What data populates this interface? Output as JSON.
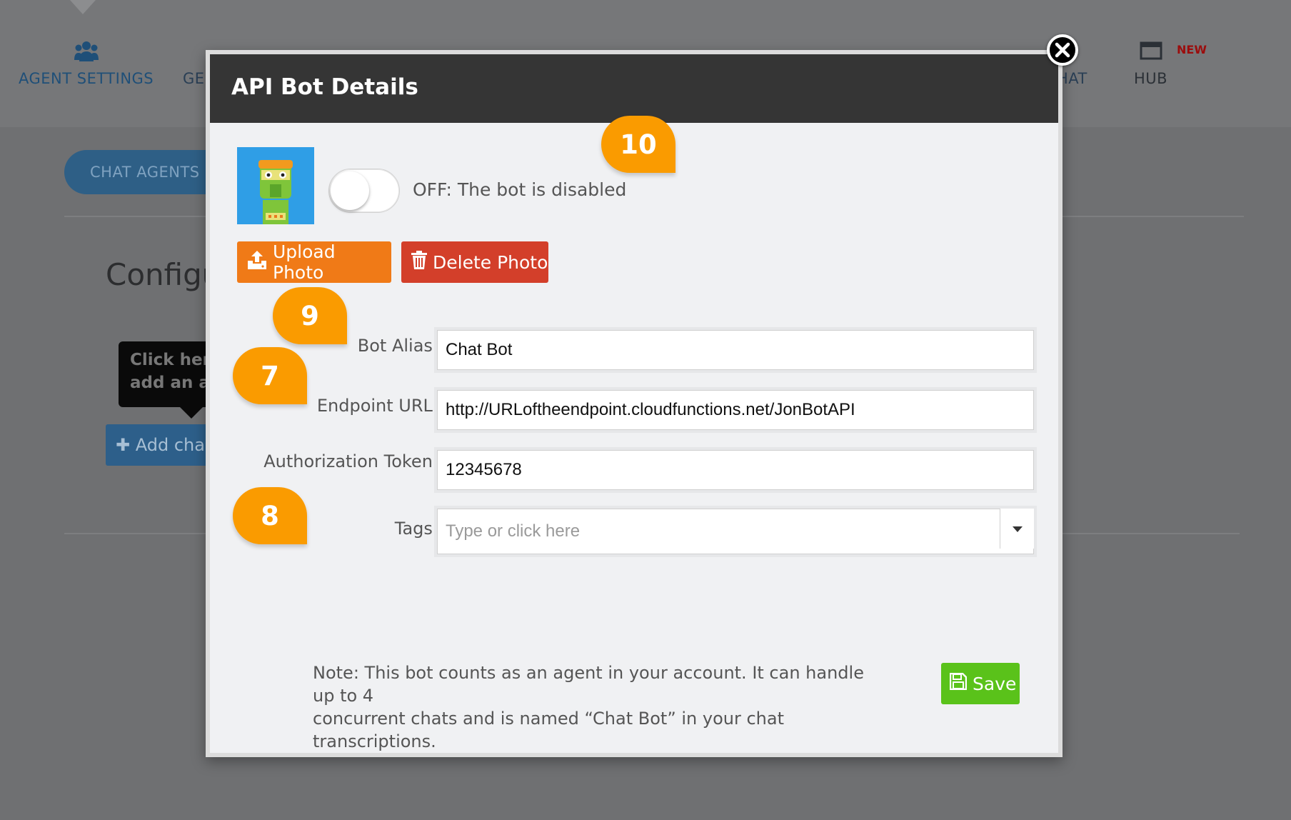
{
  "nav": {
    "agent_settings": "AGENT SETTINGS",
    "ge_partial": "GE",
    "chat_partial": "HAT",
    "hub": "HUB",
    "new_badge": "NEW"
  },
  "background": {
    "tab_chat_agents": "CHAT AGENTS",
    "config_title": "Configu",
    "tooltip_line1": "Click her",
    "tooltip_line2": "add an a",
    "add_button": "Add cha"
  },
  "modal": {
    "title": "API Bot Details",
    "toggle_state": "OFF: The bot is disabled",
    "upload_photo": "Upload Photo",
    "delete_photo": "Delete Photo",
    "fields": {
      "bot_alias_label": "Bot Alias:",
      "bot_alias_value": "Chat Bot",
      "endpoint_label": "Endpoint URL:",
      "endpoint_value": "http://URLoftheendpoint.cloudfunctions.net/JonBotAPI",
      "auth_label": "Authorization Token:",
      "auth_value": "12345678",
      "tags_label": "Tags:",
      "tags_placeholder": "Type or click here"
    },
    "note_line1": "Note: This bot counts as an agent in your account. It can handle up to 4",
    "note_line2": "concurrent chats and is named “Chat Bot” in your chat transcriptions.",
    "save": "Save"
  },
  "callouts": {
    "c10": "10",
    "c9": "9",
    "c7": "7",
    "c8": "8"
  },
  "colors": {
    "modal_header": "#353535",
    "upload_button": "#f07a17",
    "delete_button": "#d33f2a",
    "save_button": "#5ac21a",
    "callout": "#fa9b00"
  }
}
